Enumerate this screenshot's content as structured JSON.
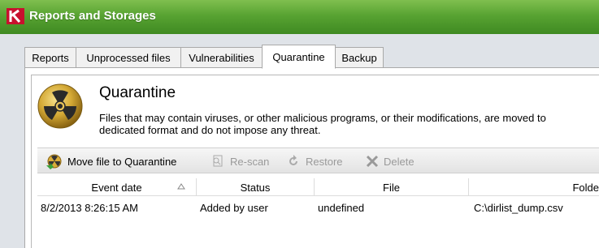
{
  "window": {
    "title": "Reports and Storages"
  },
  "tabs": [
    {
      "label": "Reports"
    },
    {
      "label": "Unprocessed files"
    },
    {
      "label": "Vulnerabilities"
    },
    {
      "label": "Quarantine",
      "active": true
    },
    {
      "label": "Backup"
    }
  ],
  "section": {
    "title": "Quarantine",
    "description_line1": "Files that may contain viruses, or other malicious programs, or their modifications, are moved to",
    "description_line2": "dedicated format and do not impose any threat."
  },
  "toolbar": {
    "move_label": "Move file to Quarantine",
    "rescan_label": "Re-scan",
    "restore_label": "Restore",
    "delete_label": "Delete"
  },
  "table": {
    "columns": [
      "Event date",
      "Status",
      "File",
      "Folde"
    ],
    "rows": [
      {
        "event_date": "8/2/2013 8:26:15 AM",
        "status": "Added by user",
        "file": "undefined",
        "folder": "C:\\dirlist_dump.csv"
      }
    ]
  },
  "colors": {
    "titlebar": "#58a332",
    "frame": "#dfe3e8",
    "icon_gold": "#c9a227"
  }
}
